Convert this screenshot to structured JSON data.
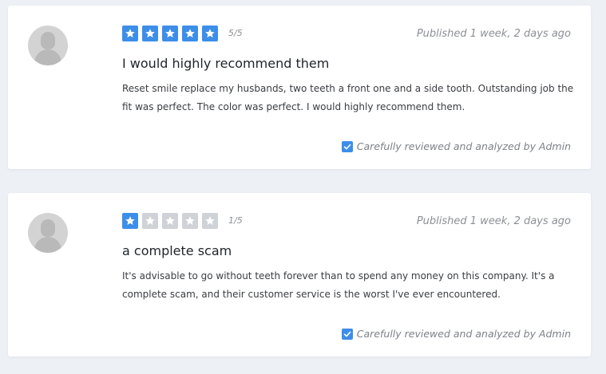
{
  "colors": {
    "star_active": "#3d8ee8",
    "star_inactive": "#cfd2d6",
    "check": "#3d8ee8",
    "background": "#edf1f6"
  },
  "icons": {
    "star": "star-icon",
    "avatar": "user-avatar-icon",
    "check": "checkbox-checked-icon"
  },
  "reviews": [
    {
      "rating": 5,
      "score_text": "5/5",
      "published": "Published 1 week, 2 days ago",
      "title": "I would highly recommend them",
      "body": "Reset smile replace my husbands, two teeth a front one and a side tooth. Outstanding job the fit was perfect. The color was perfect. I would highly recommend them.",
      "verified_text": "Carefully reviewed and analyzed by Admin"
    },
    {
      "rating": 1,
      "score_text": "1/5",
      "published": "Published 1 week, 2 days ago",
      "title": "a complete scam",
      "body": "It's advisable to go without teeth forever than to spend any money on this company. It's a complete scam, and their customer service is the worst I've ever encountered.",
      "verified_text": "Carefully reviewed and analyzed by Admin"
    }
  ]
}
